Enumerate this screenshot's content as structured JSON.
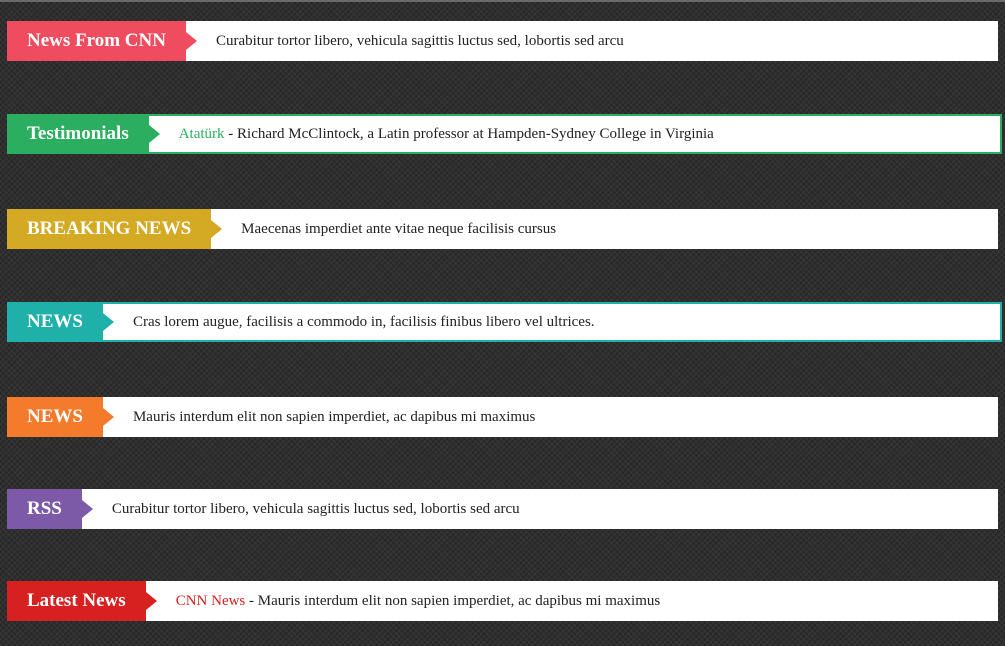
{
  "tickers": [
    {
      "label": "News From CNN",
      "color": "#f04c5f",
      "text": "Curabitur tortor libero, vehicula sagittis luctus sed, lobortis sed arcu"
    },
    {
      "label": "Testimonials",
      "color": "#2bae60",
      "source": "Atatürk",
      "text": " - Richard McClintock, a Latin professor at Hampden-Sydney College in Virginia"
    },
    {
      "label": "BREAKING NEWS",
      "color": "#d4aa25",
      "text": "Maecenas imperdiet ante vitae neque facilisis cursus"
    },
    {
      "label": "NEWS",
      "color": "#20b0aa",
      "text": "Cras lorem augue, facilisis a commodo in, facilisis finibus libero vel ultrices."
    },
    {
      "label": "NEWS",
      "color": "#f47a2c",
      "text": "Mauris interdum elit non sapien imperdiet, ac dapibus mi maximus"
    },
    {
      "label": "RSS",
      "color": "#7c5aa8",
      "text": "Curabitur tortor libero, vehicula sagittis luctus sed, lobortis sed arcu"
    },
    {
      "label": "Latest News",
      "color": "#d72020",
      "source": "CNN News",
      "text": " - Mauris interdum elit non sapien imperdiet, ac dapibus mi maximus"
    }
  ]
}
